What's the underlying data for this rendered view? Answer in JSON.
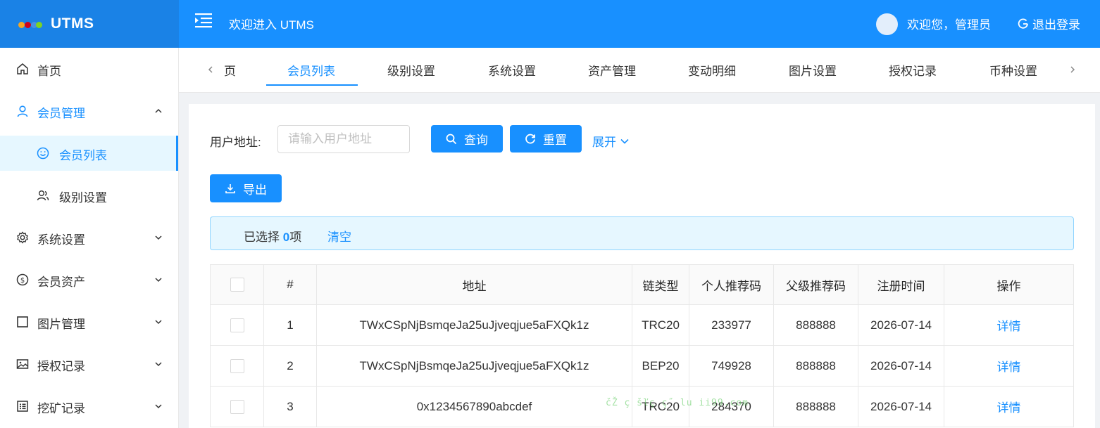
{
  "header": {
    "app_name": "UTMS",
    "welcome_title": "欢迎进入 UTMS",
    "welcome_user": "欢迎您，管理员",
    "logout_label": "退出登录",
    "colors": {
      "primary": "#1890ff",
      "logo_bg": "#1a82e6"
    }
  },
  "sidebar": {
    "items": [
      {
        "label": "首页",
        "icon": "home-icon"
      },
      {
        "label": "会员管理",
        "icon": "user-icon",
        "expanded": true
      },
      {
        "label": "会员列表",
        "icon": "smile-icon",
        "selected": true
      },
      {
        "label": "级别设置",
        "icon": "users-icon"
      },
      {
        "label": "系统设置",
        "icon": "gear-icon"
      },
      {
        "label": "会员资产",
        "icon": "dollar-icon"
      },
      {
        "label": "图片管理",
        "icon": "square-icon"
      },
      {
        "label": "授权记录",
        "icon": "image-icon"
      },
      {
        "label": "挖矿记录",
        "icon": "list-icon"
      }
    ]
  },
  "tabs": {
    "items": [
      "页",
      "会员列表",
      "级别设置",
      "系统设置",
      "资产管理",
      "变动明细",
      "图片设置",
      "授权记录",
      "币种设置"
    ],
    "active": "会员列表"
  },
  "filter": {
    "address_label": "用户地址:",
    "address_placeholder": "请输入用户地址",
    "address_value": "",
    "query_label": "查询",
    "reset_label": "重置",
    "expand_label": "展开"
  },
  "toolbar": {
    "export_label": "导出"
  },
  "selection": {
    "prefix": "已选择 ",
    "count": "0",
    "suffix": "项",
    "clear_label": "清空"
  },
  "table": {
    "columns": [
      "#",
      "地址",
      "链类型",
      "个人推荐码",
      "父级推荐码",
      "注册时间",
      "操作"
    ],
    "rows": [
      {
        "index": "1",
        "address": "TWxCSpNjBsmqeJa25uJjveqjue5aFXQk1z",
        "chain": "TRC20",
        "personal_code": "233977",
        "parent_code": "888888",
        "registered": "2026-07-14",
        "action": "详情"
      },
      {
        "index": "2",
        "address": "TWxCSpNjBsmqeJa25uJjveqjue5aFXQk1z",
        "chain": "BEP20",
        "personal_code": "749928",
        "parent_code": "888888",
        "registered": "2026-07-14",
        "action": "详情"
      },
      {
        "index": "3",
        "address": "0x1234567890abcdef",
        "chain": "TRC20",
        "personal_code": "284370",
        "parent_code": "888888",
        "registered": "2026-07-14",
        "action": "详情"
      }
    ]
  },
  "watermark": "čŽ ç šľç ç˝ lu   ii99.com"
}
